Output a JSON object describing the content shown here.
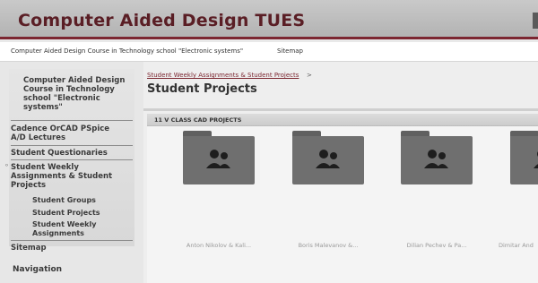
{
  "header": {
    "site_title": "Computer Aided Design TUES"
  },
  "subheader": {
    "course_link": "Computer Aided Design Course in Technology school \"Electronic systems\"",
    "sitemap_link": "Sitemap"
  },
  "sidebar": {
    "items": [
      {
        "label_lines": [
          "Computer Aided Design",
          "Course in Technology",
          "school \"Electronic",
          "systems\""
        ]
      },
      {
        "label_lines": [
          "Cadence OrCAD PSpice",
          "A/D Lectures"
        ]
      },
      {
        "label_lines": [
          "Student Questionaries"
        ]
      },
      {
        "label_lines": [
          "Student Weekly",
          "Assignments & Student",
          "Projects"
        ]
      }
    ],
    "subitems": [
      {
        "label_lines": [
          "Student Groups"
        ]
      },
      {
        "label_lines": [
          "Student Projects"
        ]
      },
      {
        "label_lines": [
          "Student Weekly",
          "Assignments"
        ]
      }
    ],
    "sitemap": "Sitemap",
    "navigation_title": "Navigation"
  },
  "main": {
    "breadcrumb": "Student Weekly Assignments & Student Projects",
    "breadcrumb_separator": ">",
    "page_title": "Student Projects",
    "section_title": "11 V CLASS CAD PROJECTS",
    "folders": [
      {
        "caption": "Anton Nikolov & Kali..."
      },
      {
        "caption": "Boris Malevanov &..."
      },
      {
        "caption": "Dilian Pechev & Pa..."
      },
      {
        "caption": "Dimitar And"
      }
    ]
  }
}
